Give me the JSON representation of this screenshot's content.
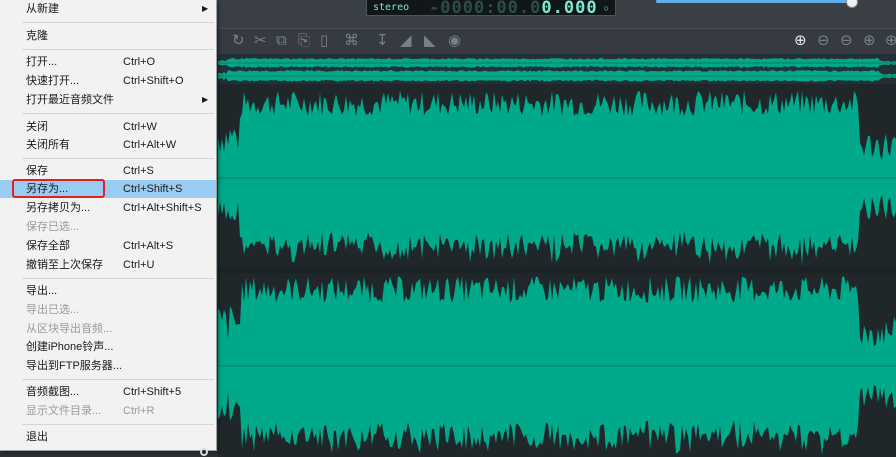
{
  "top": {
    "mode": "stereo",
    "time_dim": "-0000:00.0",
    "time_lit": "0.000"
  },
  "colors": {
    "accent": "#00a98a",
    "menu_bg": "#f2f2f2",
    "highlight": "#99ccf3",
    "red_box": "#e0211e"
  },
  "toolbar": {
    "icons": [
      "redo-icon",
      "cut-icon",
      "copy-icon",
      "paste-icon",
      "delete-icon",
      "crop-icon",
      "normalize-icon",
      "fade-in-icon",
      "fade-out-icon",
      "effects-icon",
      "zoom-in-icon",
      "zoom-out-icon",
      "zoom-fit-icon",
      "zoom-selection-icon",
      "zoom-all-icon"
    ]
  },
  "menu": {
    "items": [
      {
        "label": "从新建",
        "shortcut": "",
        "submenu": true
      },
      {
        "label": "克隆",
        "shortcut": ""
      },
      {
        "label": "打开...",
        "shortcut": "Ctrl+O"
      },
      {
        "label": "快速打开...",
        "shortcut": "Ctrl+Shift+O"
      },
      {
        "label": "打开最近音频文件",
        "shortcut": "",
        "submenu": true
      },
      {
        "label": "关闭",
        "shortcut": "Ctrl+W"
      },
      {
        "label": "关闭所有",
        "shortcut": "Ctrl+Alt+W"
      },
      {
        "label": "保存",
        "shortcut": "Ctrl+S"
      },
      {
        "label": "另存为...",
        "shortcut": "Ctrl+Shift+S"
      },
      {
        "label": "另存拷贝为...",
        "shortcut": "Ctrl+Alt+Shift+S"
      },
      {
        "label": "保存已选...",
        "shortcut": ""
      },
      {
        "label": "保存全部",
        "shortcut": "Ctrl+Alt+S"
      },
      {
        "label": "撤销至上次保存",
        "shortcut": "Ctrl+U"
      },
      {
        "label": "导出...",
        "shortcut": ""
      },
      {
        "label": "导出已选...",
        "shortcut": ""
      },
      {
        "label": "从区块导出音频...",
        "shortcut": ""
      },
      {
        "label": "创建iPhone铃声...",
        "shortcut": ""
      },
      {
        "label": "导出到FTP服务器...",
        "shortcut": ""
      },
      {
        "label": "音频截图...",
        "shortcut": "Ctrl+Shift+5"
      },
      {
        "label": "显示文件目录...",
        "shortcut": "Ctrl+R"
      },
      {
        "label": "退出",
        "shortcut": ""
      }
    ]
  }
}
